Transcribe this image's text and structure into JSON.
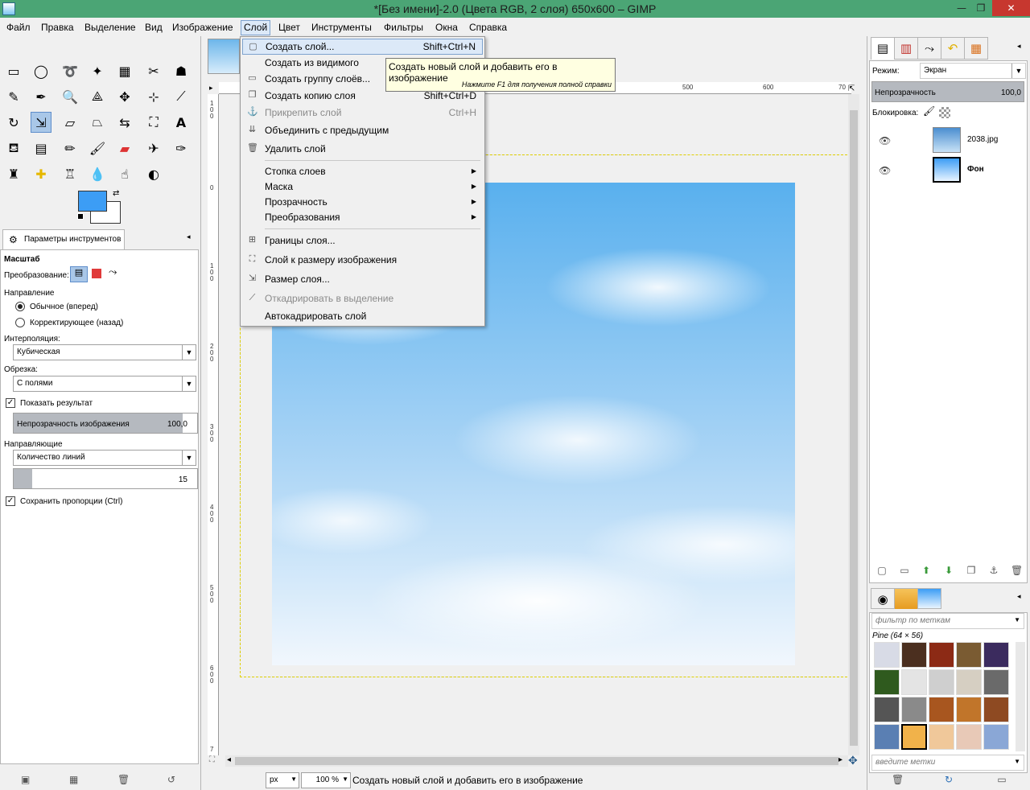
{
  "window": {
    "title": "*[Без имени]-2.0 (Цвета RGB, 2 слоя) 650x600 – GIMP",
    "minimize": "—",
    "restore": "❐",
    "close": "✕"
  },
  "menubar": [
    "Файл",
    "Правка",
    "Выделение",
    "Вид",
    "Изображение",
    "Слой",
    "Цвет",
    "Инструменты",
    "Фильтры",
    "Окна",
    "Справка"
  ],
  "layer_menu": {
    "items": [
      {
        "label": "Создать слой...",
        "shortcut": "Shift+Ctrl+N",
        "icon": "new-layer-icon"
      },
      {
        "label": "Создать из видимого",
        "shortcut": "",
        "icon": ""
      },
      {
        "label": "Создать группу слоёв...",
        "shortcut": "",
        "icon": "folder-icon"
      },
      {
        "label": "Создать копию слоя",
        "shortcut": "Shift+Ctrl+D",
        "icon": "duplicate-layer-icon"
      },
      {
        "label": "Прикрепить слой",
        "shortcut": "Ctrl+H",
        "icon": "anchor-icon"
      },
      {
        "label": "Объединить с предыдущим",
        "shortcut": "",
        "icon": "merge-down-icon"
      },
      {
        "label": "Удалить слой",
        "shortcut": "",
        "icon": "trash-icon"
      },
      {
        "label": "Стопка слоев",
        "shortcut": "",
        "icon": ""
      },
      {
        "label": "Маска",
        "shortcut": "",
        "icon": ""
      },
      {
        "label": "Прозрачность",
        "shortcut": "",
        "icon": ""
      },
      {
        "label": "Преобразования",
        "shortcut": "",
        "icon": ""
      },
      {
        "label": "Границы слоя...",
        "shortcut": "",
        "icon": "layer-boundary-icon"
      },
      {
        "label": "Слой к размеру изображения",
        "shortcut": "",
        "icon": "layer-to-image-size-icon"
      },
      {
        "label": "Размер слоя...",
        "shortcut": "",
        "icon": "scale-layer-icon"
      },
      {
        "label": "Откадрировать в выделение",
        "shortcut": "",
        "icon": "crop-icon"
      },
      {
        "label": "Автокадрировать слой",
        "shortcut": "",
        "icon": ""
      }
    ]
  },
  "tooltip": {
    "main": "Создать новый слой и добавить его в изображение",
    "hint": "Нажмите F1 для получения полной справки"
  },
  "tool_options": {
    "tab_label": "Параметры инструментов",
    "tool_name": "Масштаб",
    "transform_label": "Преобразование:",
    "direction_label": "Направление",
    "direction_normal": "Обычное (вперед)",
    "direction_corrective": "Корректирующее (назад)",
    "interpolation_label": "Интерполяция:",
    "interpolation_value": "Кубическая",
    "clipping_label": "Обрезка:",
    "clipping_value": "С полями",
    "show_preview": "Показать результат",
    "opacity_label": "Непрозрачность изображения",
    "opacity_value": "100,0",
    "guides_label": "Направляющие",
    "guides_value": "Количество линий",
    "lines_value": "15",
    "keep_aspect": "Сохранить пропорции  (Ctrl)"
  },
  "rulers": {
    "h_ticks": [
      "500",
      "600",
      "70"
    ],
    "v_ticks": [
      "1\n0\n0",
      "0",
      "1\n0\n0",
      "2\n0\n0",
      "3\n0\n0",
      "4\n0\n0",
      "5\n0\n0",
      "6\n0\n0",
      "7"
    ]
  },
  "status": {
    "unit": "px",
    "zoom": "100 %",
    "message": "Создать новый слой и добавить его в изображение"
  },
  "layers": {
    "mode_label": "Режим:",
    "mode_value": "Экран",
    "opacity_label": "Непрозрачность",
    "opacity_value": "100,0",
    "lock_label": "Блокировка:",
    "items": [
      {
        "name": "2038.jpg"
      },
      {
        "name": "Фон"
      }
    ]
  },
  "patterns": {
    "filter_placeholder": "фильтр по меткам",
    "current": "Pine (64 × 56)",
    "tags_placeholder": "введите метки"
  },
  "colors": {
    "foreground": "#3c9df5",
    "background": "#ffffff",
    "titlebar": "#4ba575",
    "menu_highlight": "#dce9f8"
  }
}
